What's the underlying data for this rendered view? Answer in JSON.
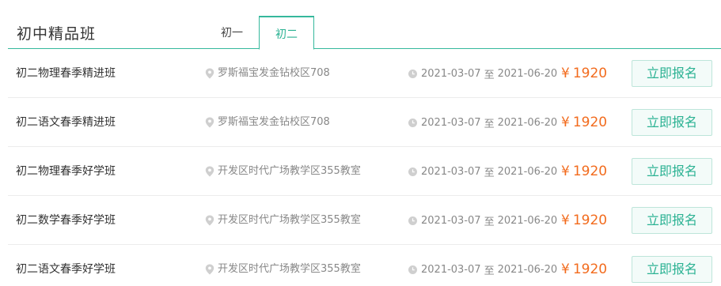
{
  "header": {
    "title": "初中精品班",
    "tabs": [
      {
        "label": "初一",
        "active": false
      },
      {
        "label": "初二",
        "active": true
      }
    ]
  },
  "colors": {
    "accent": "#35b89c",
    "price": "#f26b1d",
    "muted": "#888888"
  },
  "icons": {
    "location": "location-pin-icon",
    "time": "clock-icon"
  },
  "courses": [
    {
      "name": "初二物理春季精进班",
      "location": "罗斯福宝发金钻校区708",
      "start": "2021-03-07",
      "to": "至",
      "end": "2021-06-20",
      "currency": "¥",
      "price": "1920",
      "action": "立即报名"
    },
    {
      "name": "初二语文春季精进班",
      "location": "罗斯福宝发金钻校区708",
      "start": "2021-03-07",
      "to": "至",
      "end": "2021-06-20",
      "currency": "¥",
      "price": "1920",
      "action": "立即报名"
    },
    {
      "name": "初二物理春季好学班",
      "location": "开发区时代广场教学区355教室",
      "start": "2021-03-07",
      "to": "至",
      "end": "2021-06-20",
      "currency": "¥",
      "price": "1920",
      "action": "立即报名"
    },
    {
      "name": "初二数学春季好学班",
      "location": "开发区时代广场教学区355教室",
      "start": "2021-03-07",
      "to": "至",
      "end": "2021-06-20",
      "currency": "¥",
      "price": "1920",
      "action": "立即报名"
    },
    {
      "name": "初二语文春季好学班",
      "location": "开发区时代广场教学区355教室",
      "start": "2021-03-07",
      "to": "至",
      "end": "2021-06-20",
      "currency": "¥",
      "price": "1920",
      "action": "立即报名"
    }
  ]
}
